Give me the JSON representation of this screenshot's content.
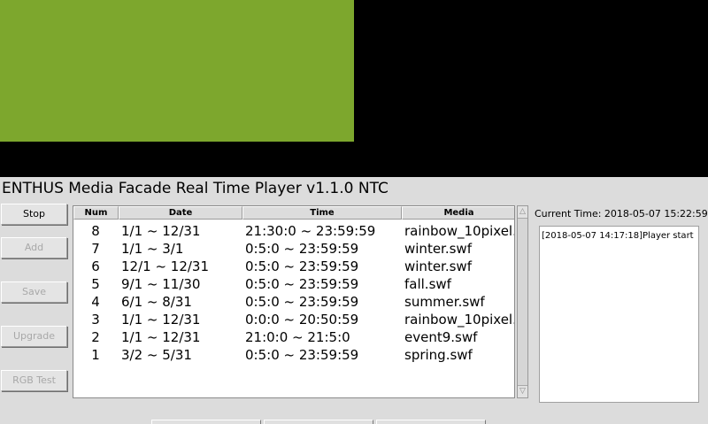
{
  "preview": {
    "green_color": "#7da72d",
    "black_color": "#000000"
  },
  "app_title": "ENTHUS Media Facade Real Time Player v1.1.0 NTC",
  "sidebar": {
    "buttons": [
      {
        "label": "Stop",
        "enabled": true
      },
      {
        "label": "Add",
        "enabled": false
      },
      {
        "label": "Save",
        "enabled": false
      },
      {
        "label": "Upgrade",
        "enabled": false
      },
      {
        "label": "RGB Test",
        "enabled": false
      }
    ]
  },
  "table": {
    "columns": [
      "Num",
      "Date",
      "Time",
      "Media"
    ],
    "rows": [
      {
        "num": "8",
        "date": "1/1 ~ 12/31",
        "time": "21:30:0 ~ 23:59:59",
        "media": "rainbow_10pixel."
      },
      {
        "num": "7",
        "date": "1/1 ~ 3/1",
        "time": "0:5:0 ~ 23:59:59",
        "media": "winter.swf"
      },
      {
        "num": "6",
        "date": "12/1 ~ 12/31",
        "time": "0:5:0 ~ 23:59:59",
        "media": "winter.swf"
      },
      {
        "num": "5",
        "date": "9/1 ~ 11/30",
        "time": "0:5:0 ~ 23:59:59",
        "media": "fall.swf"
      },
      {
        "num": "4",
        "date": "6/1 ~ 8/31",
        "time": "0:5:0 ~ 23:59:59",
        "media": "summer.swf"
      },
      {
        "num": "3",
        "date": "1/1 ~ 12/31",
        "time": "0:0:0 ~ 20:50:59",
        "media": "rainbow_10pixel."
      },
      {
        "num": "2",
        "date": "1/1 ~ 12/31",
        "time": "21:0:0 ~ 21:5:0",
        "media": "event9.swf"
      },
      {
        "num": "1",
        "date": "3/2 ~ 5/31",
        "time": "0:5:0 ~ 23:59:59",
        "media": "spring.swf"
      }
    ]
  },
  "scrollbar": {
    "up_icon": "triangle-up-icon",
    "down_icon": "triangle-down-icon"
  },
  "status": {
    "current_time": "Current Time: 2018-05-07 15:22:59"
  },
  "log": {
    "text": "[2018-05-07 14:17:18]Player start"
  }
}
